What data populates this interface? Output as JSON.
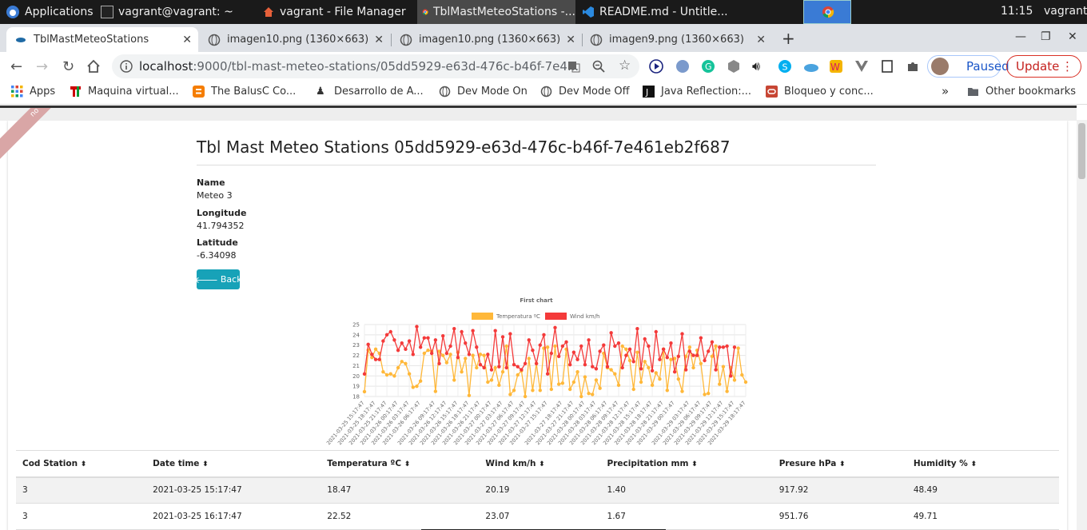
{
  "panel": {
    "applications": "Applications",
    "tasks": [
      {
        "label": "vagrant@vagrant: ~"
      },
      {
        "label": "vagrant - File Manager"
      },
      {
        "label": "TblMastMeteoStations -..."
      },
      {
        "label": "README.md - Untitle..."
      }
    ],
    "clock": "11:15",
    "user": "vagrant"
  },
  "browser": {
    "tabs": [
      {
        "label": "TblMastMeteoStations"
      },
      {
        "label": "imagen10.png (1360×663)"
      },
      {
        "label": "imagen10.png (1360×663)"
      },
      {
        "label": "imagen9.png (1360×663)"
      }
    ],
    "url_host": "localhost",
    "url_path": ":9000/tbl-mast-meteo-stations/05dd5929-e63d-476c-b46f-7e4...",
    "paused_label": "Paused",
    "update_label": "Update",
    "bookmarks": [
      {
        "label": "Apps"
      },
      {
        "label": "Maquina virtual..."
      },
      {
        "label": "The BalusC Co..."
      },
      {
        "label": "Desarrollo de A..."
      },
      {
        "label": "Dev Mode On"
      },
      {
        "label": "Dev Mode Off"
      },
      {
        "label": "Java Reflection:..."
      },
      {
        "label": "Bloqueo y conc..."
      }
    ],
    "other_bookmarks": "Other bookmarks",
    "more": "»"
  },
  "page": {
    "ribbon_text": "no",
    "title": "Tbl Mast Meteo Stations 05dd5929-e63d-476c-b46f-7e461eb2f687",
    "fields": [
      {
        "label": "Name",
        "value": "Meteo 3"
      },
      {
        "label": "Longitude",
        "value": "41.794352"
      },
      {
        "label": "Latitude",
        "value": "-6.34098"
      }
    ],
    "back_label": "Back"
  },
  "chart_data": {
    "type": "line",
    "title": "First chart",
    "ylim": [
      18,
      25
    ],
    "yticks": [
      18,
      19,
      20,
      21,
      22,
      23,
      24,
      25
    ],
    "legend_position": "top",
    "grid": true,
    "x_tick_labels": [
      "2021-03-25 15:17:47",
      "2021-03-25 18:17:47",
      "2021-03-25 21:17:47",
      "2021-03-26 00:17:47",
      "2021-03-26 03:17:47",
      "2021-03-26 06:17:47",
      "2021-03-26 09:17:47",
      "2021-03-26 12:17:47",
      "2021-03-26 15:17:47",
      "2021-03-26 18:17:47",
      "2021-03-26 21:17:47",
      "2021-03-27 00:17:47",
      "2021-03-27 03:17:47",
      "2021-03-27 06:17:47",
      "2021-03-27 09:17:47",
      "2021-03-27 12:17:47",
      "2021-03-27 15:17:47",
      "2021-03-27 18:17:47",
      "2021-03-27 21:17:47",
      "2021-03-28 00:17:47",
      "2021-03-28 03:17:47",
      "2021-03-28 06:17:47",
      "2021-03-28 09:17:47",
      "2021-03-28 12:17:47",
      "2021-03-28 15:17:47",
      "2021-03-28 18:17:47",
      "2021-03-28 21:17:47",
      "2021-03-29 00:17:47",
      "2021-03-29 03:17:47",
      "2021-03-29 06:17:47",
      "2021-03-29 09:17:47",
      "2021-03-29 12:17:47",
      "2021-03-29 15:17:47",
      "2021-03-29 18:17:47"
    ],
    "series": [
      {
        "name": "Temperatura ºC",
        "color": "#ffb83a",
        "values": [
          18.47,
          22.52,
          21.8,
          22.6,
          22.2,
          20.4,
          20.1,
          20.2,
          20.0,
          20.8,
          21.4,
          21.2,
          20.2,
          18.9,
          19.0,
          19.5,
          22.2,
          22.5,
          22.4,
          18.5,
          22.4,
          22.0,
          21.3,
          22.1,
          19.6,
          22.3,
          20.4,
          21.7,
          18.1,
          22.0,
          20.8,
          22.1,
          22.0,
          19.4,
          19.6,
          20.8,
          19.1,
          20.4,
          22.9,
          18.2,
          18.6,
          20.1,
          20.5,
          18.0,
          21.7,
          18.6,
          21.2,
          18.6,
          22.7,
          22.8,
          18.7,
          22.9,
          19.2,
          19.3,
          22.6,
          18.7,
          19.4,
          20.4,
          18.0,
          19.9,
          18.3,
          18.2,
          19.6,
          18.8,
          22.2,
          20.8,
          20.6,
          20.2,
          19.1,
          22.9,
          22.6,
          21.5,
          18.7,
          22.3,
          19.4,
          21.4,
          20.8,
          19.1,
          20.3,
          19.7,
          22.6,
          18.6,
          21.6,
          21.7,
          19.7,
          18.5,
          21.9,
          22.8,
          20.8,
          22.5,
          21.2,
          18.2,
          18.3,
          21.9,
          22.9,
          19.2,
          20.9,
          18.5,
          20.8,
          19.6,
          22.7,
          20.1,
          19.4
        ]
      },
      {
        "name": "Wind km/h",
        "color": "#f43a3a",
        "values": [
          20.19,
          23.07,
          22.1,
          21.6,
          21.6,
          23.4,
          24.0,
          24.3,
          23.5,
          22.5,
          23.2,
          22.6,
          23.4,
          22.1,
          24.8,
          22.8,
          23.7,
          23.7,
          22.2,
          23.5,
          21.2,
          23.9,
          22.2,
          22.9,
          24.6,
          21.8,
          24.3,
          23.2,
          22.1,
          24.4,
          22.8,
          21.1,
          20.8,
          22.1,
          20.6,
          24.4,
          20.9,
          23.8,
          20.8,
          24.1,
          21.1,
          20.9,
          20.6,
          21.2,
          23.5,
          22.5,
          21.2,
          23.0,
          24.0,
          20.2,
          22.2,
          24.7,
          21.9,
          22.9,
          23.3,
          21.1,
          22.3,
          21.6,
          22.9,
          21.1,
          23.5,
          20.9,
          20.7,
          22.4,
          23.0,
          20.9,
          24.2,
          22.9,
          23.2,
          20.8,
          22.0,
          22.6,
          21.4,
          24.6,
          20.7,
          23.6,
          22.9,
          20.5,
          24.3,
          21.6,
          22.6,
          21.8,
          23.2,
          20.4,
          21.9,
          24.1,
          20.6,
          22.4,
          22.0,
          22.0,
          23.7,
          21.5,
          22.4,
          23.3,
          20.6,
          22.8,
          22.8,
          22.9,
          20.0,
          22.8
        ]
      }
    ]
  },
  "table": {
    "headers": [
      "Cod Station",
      "Date time",
      "Temperatura ºC",
      "Wind km/h",
      "Precipitation mm",
      "Presure hPa",
      "Humidity %"
    ],
    "rows": [
      [
        "3",
        "2021-03-25 15:17:47",
        "18.47",
        "20.19",
        "1.40",
        "917.92",
        "48.49"
      ],
      [
        "3",
        "2021-03-25 16:17:47",
        "22.52",
        "23.07",
        "1.67",
        "951.76",
        "49.71"
      ]
    ]
  }
}
